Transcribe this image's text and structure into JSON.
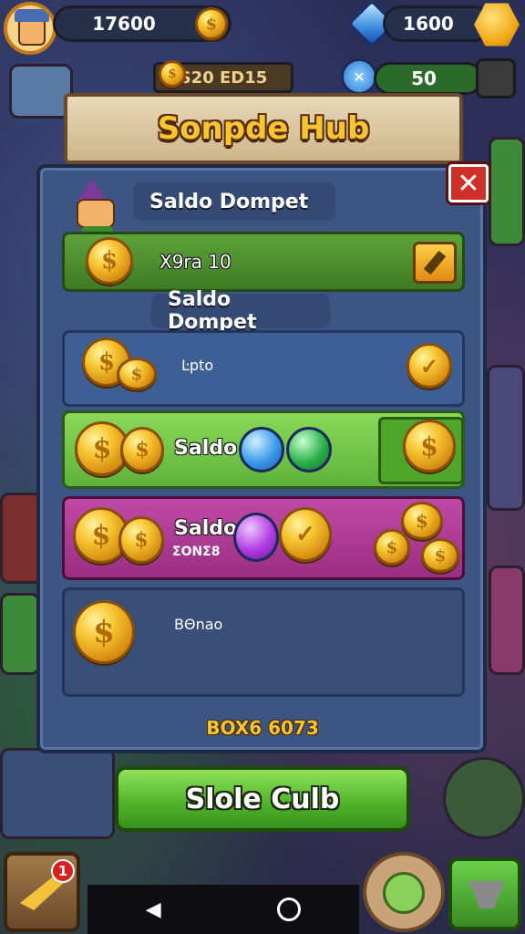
{
  "hud": {
    "player_coins": "17600",
    "gems": "1600",
    "center_value": "S20 ED15",
    "energy": "50"
  },
  "panel": {
    "title": "Sonpde Hub",
    "header_label": "Saldo Dompet",
    "green_row_text": "X9ra 10",
    "sub_label": "Saldo Dompet",
    "row1_text": "Ŀpto",
    "row2_text": "Saldo",
    "row3_title": "Saldo",
    "row3_sub": "ΣΟΝΣ8",
    "row4_text": "BΘnao",
    "footer": "BOX6 6073",
    "coin_symbol": "$"
  },
  "action_button": "Slole Culb",
  "corner_badge": "1",
  "colors": {
    "green_row": "#4f8a2a",
    "blue_row": "#3e5f95",
    "light_green_row": "#74c94a",
    "magenta_row": "#b23c96",
    "dark_row": "#3a4f78",
    "coin_gold": "#f7c531"
  }
}
